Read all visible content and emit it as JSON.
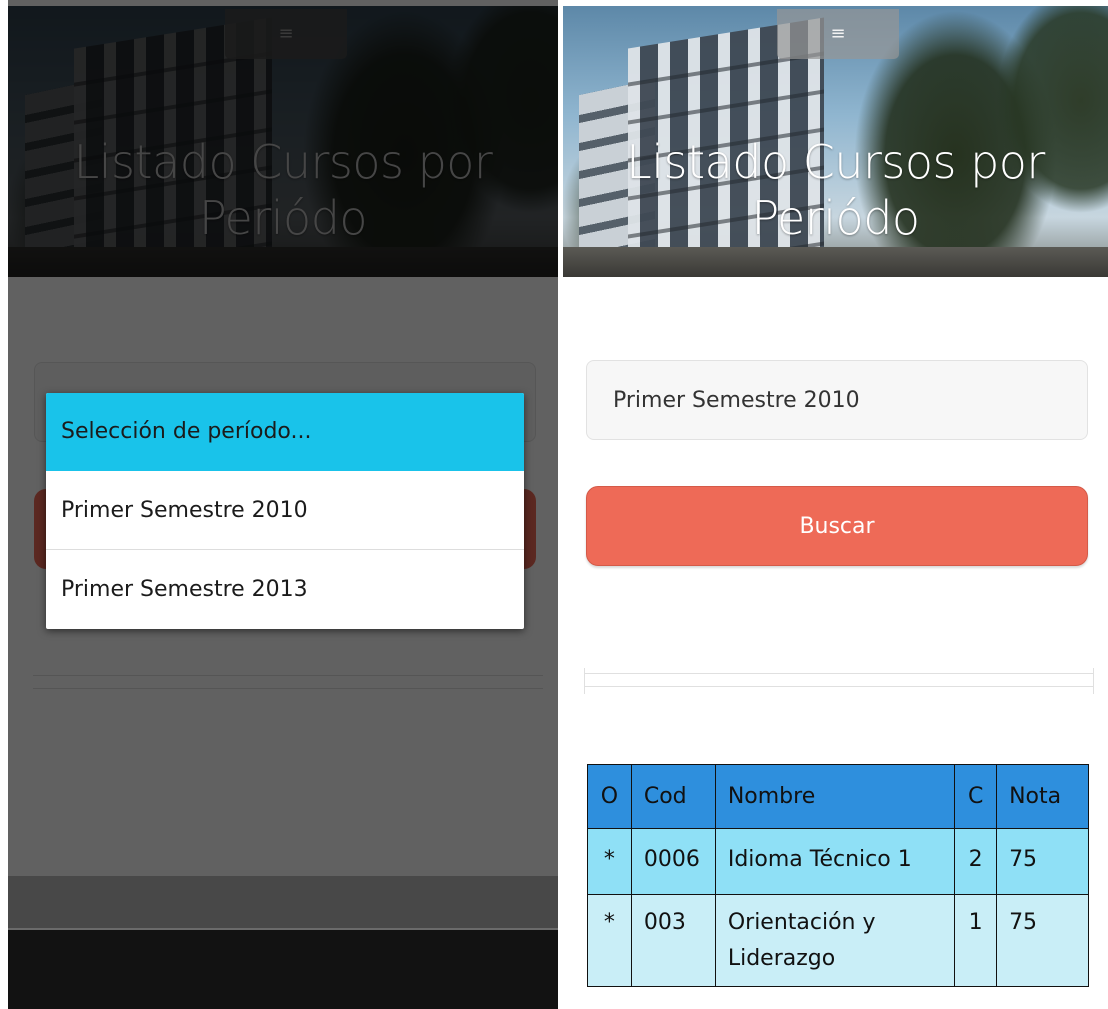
{
  "hero": {
    "title_line1": "Listado Cursos por",
    "title_line2": "Periódo"
  },
  "menu_glyph": "≡",
  "dialog": {
    "title": "Selección de período...",
    "options": [
      "Primer Semestre 2010",
      "Primer Semestre 2013"
    ]
  },
  "form": {
    "selected_period": "Primer Semestre 2010",
    "search_label": "Buscar"
  },
  "table": {
    "headers": [
      "O",
      "Cod",
      "Nombre",
      "C",
      "Nota"
    ],
    "rows": [
      {
        "o": "*",
        "cod": "0006",
        "nombre": "Idioma Técnico 1",
        "c": "2",
        "nota": "75"
      },
      {
        "o": "*",
        "cod": "003",
        "nombre": "Orientación y Liderazgo",
        "c": "1",
        "nota": "75"
      }
    ]
  },
  "colors": {
    "accent_cyan": "#19c3ea",
    "button_red": "#ee6a57",
    "table_header": "#2e8fdd",
    "row1": "#8fe0f6",
    "row2": "#c9eef7"
  }
}
